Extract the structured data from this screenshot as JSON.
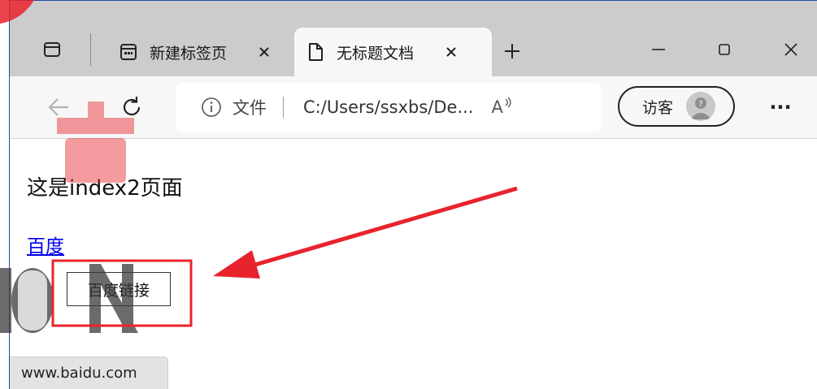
{
  "tabs": [
    {
      "title": "新建标签页",
      "icon": "new-tab-page-icon"
    },
    {
      "title": "无标题文档",
      "icon": "document-icon"
    }
  ],
  "toolbar": {
    "address_scheme": "文件",
    "address_url": "C:/Users/ssxbs/De...",
    "read_aloud_label": "A",
    "profile_label": "访客",
    "more_label": "···"
  },
  "page": {
    "heading": "这是index2页面",
    "link_text": "百度",
    "button_label": "百度链接",
    "status_url": "www.baidu.com"
  },
  "colors": {
    "tabstrip": "#cccccc",
    "toolbar": "#f7f7f7",
    "link": "#0000ee",
    "annotation": "#e8232d",
    "window_border": "#1e4da3"
  }
}
